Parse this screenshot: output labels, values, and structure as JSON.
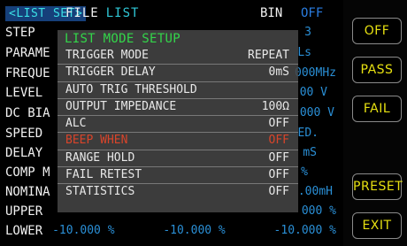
{
  "top_tabs": {
    "list_setup": "<LIST SET>",
    "file_1": "FILE",
    "file_2": "LIST"
  },
  "bin": {
    "label": "BIN",
    "value": "OFF"
  },
  "background_rows": [
    {
      "label": "STEP",
      "value": "3"
    },
    {
      "label": "PARAME",
      "value": "Ls"
    },
    {
      "label": "FREQUE",
      "value": "000MHz"
    },
    {
      "label": "LEVEL",
      "value": "00 V"
    },
    {
      "label": "DC BIA",
      "value": "000 V"
    },
    {
      "label": "SPEED",
      "value": "ED."
    },
    {
      "label": "DELAY",
      "value": "mS"
    },
    {
      "label": "COMP M",
      "value": "%"
    },
    {
      "label": "NOMINA",
      "value": ".00mH"
    },
    {
      "label": "UPPER",
      "value": "000 %"
    },
    {
      "label": "LOWER",
      "value": "-10.000 %       -10.000 %       -10.000 %"
    }
  ],
  "popup": {
    "title": "LIST MODE SETUP",
    "rows": [
      {
        "label": "TRIGGER MODE",
        "value": "REPEAT"
      },
      {
        "label": "TRIGGER DELAY",
        "value": "0mS"
      },
      {
        "label": "AUTO TRIG THRESHOLD",
        "value": ""
      },
      {
        "label": "OUTPUT IMPEDANCE",
        "value": "100Ω"
      },
      {
        "label": "ALC",
        "value": "OFF"
      },
      {
        "label": "BEEP WHEN",
        "value": "OFF"
      },
      {
        "label": "RANGE HOLD",
        "value": "OFF"
      },
      {
        "label": "FAIL RETEST",
        "value": "OFF"
      },
      {
        "label": "STATISTICS",
        "value": "OFF"
      }
    ],
    "selected_row": "BEEP WHEN"
  },
  "softkeys": [
    "OFF",
    "PASS",
    "FAIL",
    "PRESET",
    "EXIT"
  ],
  "colors": {
    "tab_bg": "#16407a",
    "tab_text": "#3be0e6",
    "value_blue": "#2a8fd6",
    "popup_title": "#33d64a",
    "selected_text": "#d9442a",
    "softkey_text": "#e6e011"
  }
}
